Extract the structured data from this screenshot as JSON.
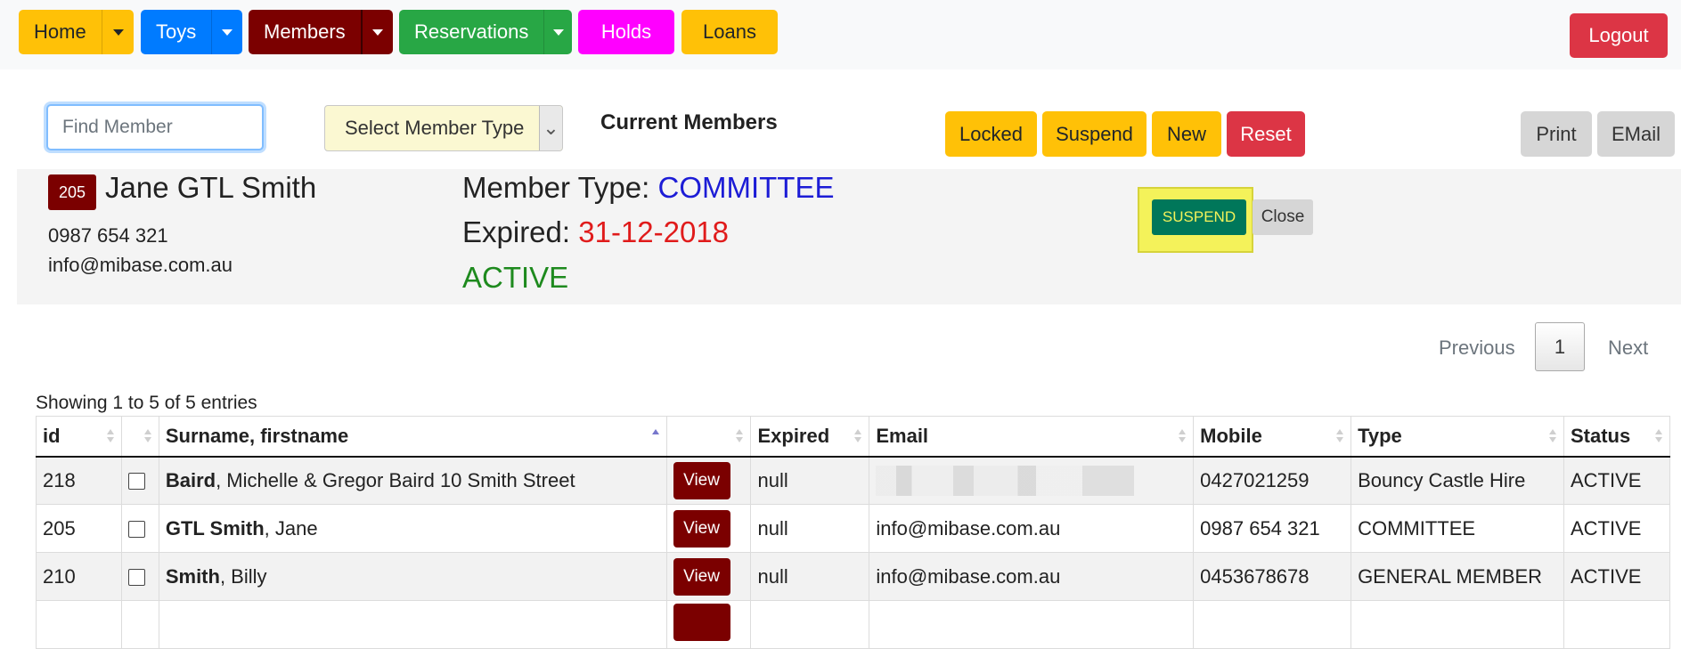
{
  "nav": {
    "home": "Home",
    "toys": "Toys",
    "members": "Members",
    "reservations": "Reservations",
    "holds": "Holds",
    "loans": "Loans",
    "logout": "Logout"
  },
  "colors": {
    "home": "#ffc107",
    "toys": "#007bff",
    "members": "#7b0000",
    "reservations": "#28a745",
    "holds": "#ff00ff",
    "loans": "#ffc107",
    "logout": "#dc3545",
    "suspend_highlight": "#f4f25a"
  },
  "toolbar": {
    "find_placeholder": "Find Member",
    "member_type_select": "Select Member Type",
    "title": "Current Members",
    "locked": "Locked",
    "suspend": "Suspend",
    "new": "New",
    "reset": "Reset",
    "print": "Print",
    "email": "EMail"
  },
  "member": {
    "id": "205",
    "name": "Jane GTL Smith",
    "phone": "0987 654 321",
    "email": "info@mibase.com.au",
    "type_label": "Member Type: ",
    "type": "COMMITTEE",
    "expired_label": "Expired: ",
    "expired": "31-12-2018",
    "status": "ACTIVE",
    "suspend_button": "SUSPEND",
    "close_button": "Close"
  },
  "pager": {
    "previous": "Previous",
    "page": "1",
    "next": "Next"
  },
  "table": {
    "info": "Showing 1 to 5 of 5 entries",
    "headers": {
      "id": "id",
      "name": "Surname, firstname",
      "expired": "Expired",
      "email": "Email",
      "mobile": "Mobile",
      "type": "Type",
      "status": "Status"
    },
    "view_label": "View",
    "rows": [
      {
        "id": "218",
        "surname": "Baird",
        "rest": ", Michelle & Gregor Baird 10 Smith Street",
        "expired": "null",
        "email": "",
        "mobile": "0427021259",
        "type": "Bouncy Castle Hire",
        "status": "ACTIVE"
      },
      {
        "id": "205",
        "surname": "GTL Smith",
        "rest": ", Jane",
        "expired": "null",
        "email": "info@mibase.com.au",
        "mobile": "0987 654 321",
        "type": "COMMITTEE",
        "status": "ACTIVE"
      },
      {
        "id": "210",
        "surname": "Smith",
        "rest": ", Billy",
        "expired": "null",
        "email": "info@mibase.com.au",
        "mobile": "0453678678",
        "type": "GENERAL MEMBER",
        "status": "ACTIVE"
      }
    ]
  }
}
